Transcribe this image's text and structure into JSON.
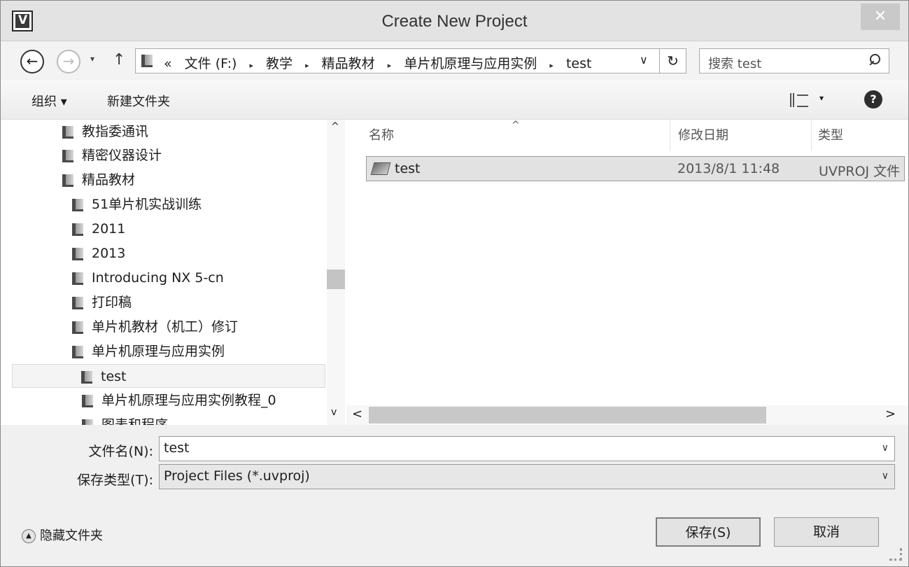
{
  "window": {
    "title": "Create New Project",
    "close_label": "✕"
  },
  "nav": {
    "back_label": "←",
    "forward_label": "→",
    "recent_label": "▾",
    "up_label": "↑",
    "breadcrumb_prefix": "«",
    "breadcrumbs": [
      "文件 (F:)",
      "教学",
      "精品教材",
      "单片机原理与应用实例",
      "test"
    ],
    "breadcrumb_separator": "▸",
    "address_dropdown": "∨",
    "refresh_label": "↻",
    "search_placeholder": "搜索 test"
  },
  "toolbar": {
    "organize_label": "组织 ▾",
    "new_folder_label": "新建文件夹",
    "view_dropdown": "▾",
    "help_label": "?"
  },
  "tree": {
    "items": [
      {
        "label": "教指委通讯"
      },
      {
        "label": "精密仪器设计"
      },
      {
        "label": "精品教材"
      },
      {
        "label": "51单片机实战训练"
      },
      {
        "label": "2011"
      },
      {
        "label": "2013"
      },
      {
        "label": "Introducing NX 5-cn"
      },
      {
        "label": "打印稿"
      },
      {
        "label": "单片机教材（机工）修订"
      },
      {
        "label": "单片机原理与应用实例"
      },
      {
        "label": "test"
      },
      {
        "label": "单片机原理与应用实例教程_0"
      },
      {
        "label": "图表和程序"
      }
    ],
    "scroll_up": "^",
    "scroll_down": "v"
  },
  "files": {
    "columns": [
      "名称",
      "修改日期",
      "类型"
    ],
    "sort_indicator": "^",
    "rows": [
      {
        "name": "test",
        "modified": "2013/8/1 11:48",
        "type": "UVPROJ 文件"
      }
    ],
    "scroll_left": "<",
    "scroll_right": ">"
  },
  "form": {
    "filename_label": "文件名(N):",
    "filename_value": "test",
    "filetype_label": "保存类型(T):",
    "filetype_value": "Project Files (*.uvproj)",
    "dropdown_chevron": "∨"
  },
  "footer": {
    "hide_folders_label": "隐藏文件夹",
    "hide_folders_icon": "▲",
    "save_label": "保存(S)",
    "cancel_label": "取消"
  }
}
